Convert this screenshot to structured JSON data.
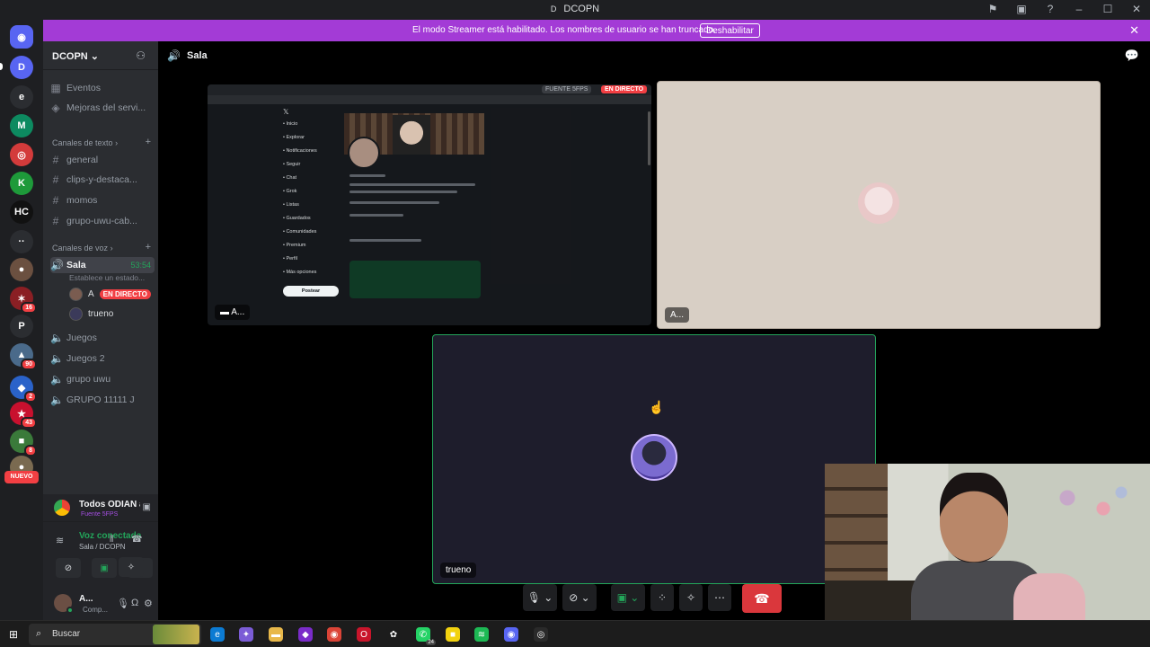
{
  "window": {
    "title": "DCOPN",
    "title_icon": "D",
    "icons": [
      "gallery-icon",
      "device-icon",
      "help-icon",
      "minimize-icon",
      "maximize-icon",
      "close-icon"
    ]
  },
  "banner": {
    "message": "El modo Streamer está habilitado. Los nombres de usuario se han truncado.",
    "button": "Deshabilitar",
    "color": "#a33bd6"
  },
  "rail": {
    "servers": [
      {
        "name": "discord-home",
        "glyph": "◉",
        "bg": "#5865f2"
      },
      {
        "name": "server-d",
        "glyph": "D",
        "bg": "#5865f2"
      },
      {
        "name": "server-e",
        "glyph": "e",
        "bg": "#2b2d31"
      },
      {
        "name": "server-m",
        "glyph": "M",
        "bg": "#0d8a60"
      },
      {
        "name": "server-red",
        "glyph": "◎",
        "bg": "#d33b3b"
      },
      {
        "name": "server-k",
        "glyph": "K",
        "bg": "#1e9a3a"
      },
      {
        "name": "server-hc",
        "glyph": "HC",
        "bg": "#111"
      },
      {
        "name": "server-dots",
        "glyph": "··",
        "bg": "#2b2d31"
      },
      {
        "name": "server-person",
        "glyph": "●",
        "bg": "#6b5040",
        "badge": ""
      },
      {
        "name": "server-red2",
        "glyph": "✶",
        "bg": "#8a1f24",
        "badge": "16"
      },
      {
        "name": "server-p",
        "glyph": "P",
        "bg": "#2b2d31"
      },
      {
        "name": "server-car",
        "glyph": "▲",
        "bg": "#4a6a8a",
        "badge": "90"
      },
      {
        "name": "server-blue",
        "glyph": "◆",
        "bg": "#2a62c9",
        "badge": "2"
      },
      {
        "name": "server-flag",
        "glyph": "★",
        "bg": "#c8102e",
        "badge": "43"
      },
      {
        "name": "server-green",
        "glyph": "■",
        "bg": "#3a7a3a",
        "badge": "8"
      },
      {
        "name": "server-mix",
        "glyph": "●",
        "bg": "#7a6a50"
      }
    ],
    "new_label": "NUEVO"
  },
  "server": {
    "name": "DCOPN",
    "events": "Eventos",
    "boosts": "Mejoras del servi...",
    "text_category": "Canales de texto",
    "text_channels": [
      "general",
      "clips-y-destaca...",
      "momos",
      "grupo-uwu-cab..."
    ],
    "voice_category": "Canales de voz",
    "active_voice": {
      "name": "Sala",
      "timer": "53:54",
      "status_hint": "Establece un estado..."
    },
    "voice_users": [
      {
        "name": "A",
        "live": "EN DIRECTO"
      },
      {
        "name": "trueno"
      }
    ],
    "voice_channels": [
      "Juegos",
      "Juegos 2",
      "grupo uwu",
      "GRUPO 11111 J"
    ]
  },
  "activity": {
    "title": "Todos ODIAN a DA...",
    "subtitle": "Fuente 5FPS"
  },
  "voice_panel": {
    "status": "Voz conectada",
    "location": "Sala / DCOPN"
  },
  "user": {
    "name": "A...",
    "status": "Comp..."
  },
  "main": {
    "channel": "Sala",
    "stream_tile": {
      "label": "A...",
      "fps_badge": "FUENTE 5FPS",
      "live_badge": "EN DIRECTO",
      "nav_items": [
        "Inicio",
        "Explorar",
        "Notificaciones",
        "Seguir",
        "Chat",
        "Grok",
        "Listas",
        "Guardados",
        "Comunidades",
        "Premium",
        "Perfil",
        "Más opciones"
      ],
      "post_button": "Postear"
    },
    "pink_tile": {
      "label": "A..."
    },
    "trueno_tile": {
      "label": "trueno"
    }
  },
  "taskbar": {
    "search": "Buscar",
    "apps": [
      {
        "name": "edge",
        "glyph": "e",
        "bg": "#0c7bd3"
      },
      {
        "name": "copilot",
        "glyph": "✦",
        "bg": "#7b5cd6"
      },
      {
        "name": "explorer",
        "glyph": "▬",
        "bg": "#e8b84a"
      },
      {
        "name": "purple-app",
        "glyph": "◆",
        "bg": "#7a2cc9"
      },
      {
        "name": "chrome",
        "glyph": "◉",
        "bg": "#db4437"
      },
      {
        "name": "opera",
        "glyph": "O",
        "bg": "#c9152b"
      },
      {
        "name": "chatgpt",
        "glyph": "✿",
        "bg": "#1c1c1c"
      },
      {
        "name": "whatsapp",
        "glyph": "✆",
        "bg": "#25d366",
        "badge": "24"
      },
      {
        "name": "notes",
        "glyph": "■",
        "bg": "#f2d20f"
      },
      {
        "name": "spotify",
        "glyph": "≋",
        "bg": "#1db954"
      },
      {
        "name": "discord",
        "glyph": "◉",
        "bg": "#5865f2"
      },
      {
        "name": "obs",
        "glyph": "◎",
        "bg": "#2a2a2a"
      }
    ]
  }
}
